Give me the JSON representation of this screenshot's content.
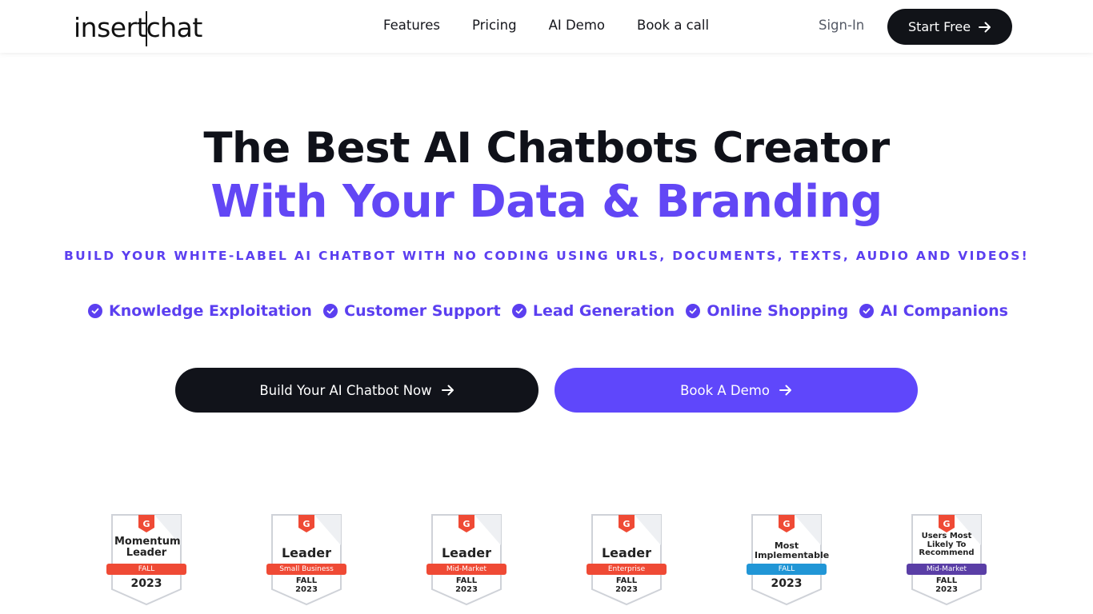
{
  "header": {
    "logo_left": "insert",
    "logo_right": "hat",
    "nav": [
      "Features",
      "Pricing",
      "AI Demo",
      "Book a call"
    ],
    "signin": "Sign-In",
    "start_free": "Start Free"
  },
  "hero": {
    "title_line1": "The Best AI Chatbots Creator",
    "title_line2": "With Your Data & Branding",
    "subtitle": "BUILD YOUR WHITE-LABEL AI CHATBOT WITH NO CODING USING URLS, DOCUMENTS, TEXTS, AUDIO AND VIDEOS!",
    "features": [
      "Knowledge Exploitation",
      "Customer Support",
      "Lead Generation",
      "Online Shopping",
      "AI Companions"
    ],
    "cta_primary": "Build Your AI Chatbot Now",
    "cta_secondary": "Book A Demo"
  },
  "badges": [
    {
      "title": "Momentum Leader",
      "ribbon": "FALL",
      "season": "",
      "year": "2023",
      "color": "#ef4a35"
    },
    {
      "title": "Leader",
      "ribbon": "Small Business",
      "season": "FALL",
      "year": "2023",
      "color": "#ef4a35"
    },
    {
      "title": "Leader",
      "ribbon": "Mid-Market",
      "season": "FALL",
      "year": "2023",
      "color": "#ef4a35"
    },
    {
      "title": "Leader",
      "ribbon": "Enterprise",
      "season": "FALL",
      "year": "2023",
      "color": "#ef4a35"
    },
    {
      "title": "Most Implementable",
      "ribbon": "FALL",
      "season": "",
      "year": "2023",
      "color": "#2196d6"
    },
    {
      "title": "Users Most Likely To Recommend",
      "ribbon": "Mid-Market",
      "season": "FALL",
      "year": "2023",
      "color": "#5a3ea6"
    }
  ],
  "colors": {
    "accent": "#5f47fb",
    "dark": "#11131a",
    "g2_red": "#ef4a35"
  }
}
